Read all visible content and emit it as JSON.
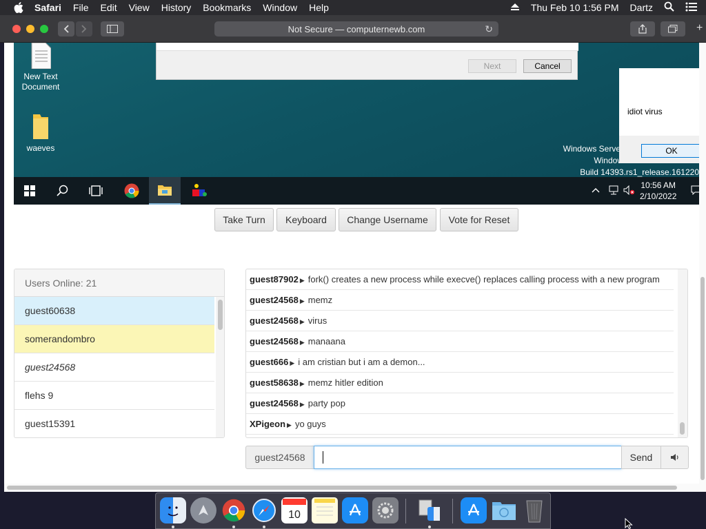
{
  "menubar": {
    "app": "Safari",
    "items": [
      "File",
      "Edit",
      "View",
      "History",
      "Bookmarks",
      "Window",
      "Help"
    ],
    "datetime": "Thu Feb 10  1:56 PM",
    "user": "Dartz"
  },
  "safari": {
    "address": "Not Secure — computernewb.com"
  },
  "remote": {
    "desktop_icons": [
      "New Text Document",
      "waeves"
    ],
    "dialog": {
      "next_label": "Next",
      "cancel_label": "Cancel"
    },
    "msgbox": {
      "text": "idiot virus",
      "ok_label": "OK"
    },
    "watermark": {
      "line1": "Windows Server",
      "line2": "Window",
      "line3": "Build 14393.rs1_release.161220-"
    },
    "clock": {
      "time": "10:56 AM",
      "date": "2/10/2022"
    }
  },
  "controls": {
    "take_turn": "Take Turn",
    "keyboard": "Keyboard",
    "change_username": "Change Username",
    "vote_reset": "Vote for Reset"
  },
  "users": {
    "header": "Users Online: 21",
    "list": [
      "guest60638",
      "somerandombro",
      "guest24568",
      "flehs 9",
      "guest15391"
    ]
  },
  "chat": {
    "messages": [
      {
        "user": "guest87902",
        "text": "fork() creates a new process while execve() replaces calling process with a new program"
      },
      {
        "user": "guest24568",
        "text": "memz"
      },
      {
        "user": "guest24568",
        "text": "virus"
      },
      {
        "user": "guest24568",
        "text": "manaana"
      },
      {
        "user": "guest666",
        "text": "i am cristian but i am a demon..."
      },
      {
        "user": "guest58638",
        "text": "memz hitler edition"
      },
      {
        "user": "guest24568",
        "text": "party pop"
      },
      {
        "user": "XPigeon",
        "text": "yo guys"
      }
    ],
    "username": "guest24568",
    "input_value": "",
    "send_label": "Send"
  },
  "icons": {
    "menubar": [
      "apple-icon",
      "eject-icon",
      "search-icon",
      "control-center-icon"
    ],
    "taskbar": [
      "windows-start-icon",
      "search-icon",
      "task-view-icon",
      "chrome-icon",
      "file-explorer-icon",
      "paint-app-icon"
    ],
    "dock": [
      "finder-icon",
      "launchpad-icon",
      "chrome-icon",
      "safari-icon",
      "calendar-icon",
      "notes-icon",
      "app-store-icon",
      "system-preferences-icon",
      "finder-alt-icon",
      "app-store-alt-icon",
      "downloads-folder-icon",
      "trash-icon"
    ]
  }
}
